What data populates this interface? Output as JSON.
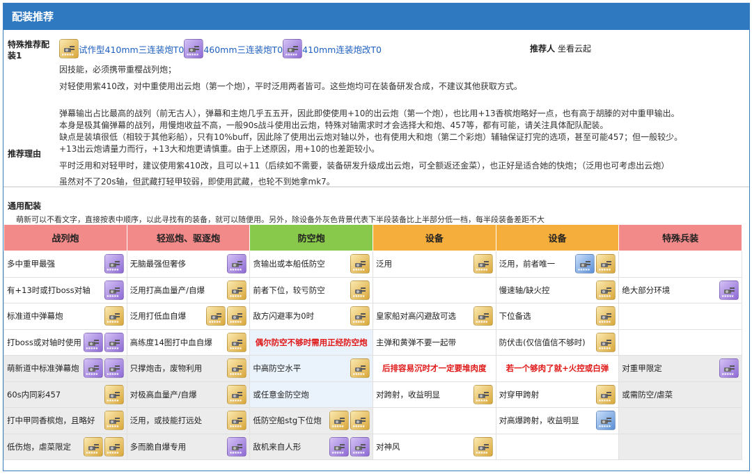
{
  "header": {
    "title": "配装推荐"
  },
  "special": {
    "label": "特殊推荐配装1",
    "equips": [
      {
        "name": "试作型410mm三连装炮T0",
        "color": "gold",
        "icon": "turret-icon"
      },
      {
        "name": "460mm三连装炮T0",
        "color": "purple",
        "icon": "turret-icon"
      },
      {
        "name": "410mm连装炮改T0",
        "color": "purple",
        "icon": "turret-icon"
      }
    ],
    "recommender_label": "推荐人",
    "recommender": "坐看云起",
    "notes": [
      "因技能，必须携带重樱战列炮；",
      "对轻使用紫410改，对中重使用出云炮（第一个炮），平时泛用两者皆可。这些炮均可在装备研发合成，不建议其他获取方式。"
    ],
    "reason_label": "推荐理由",
    "reasons": [
      "弹幕输出占比最高的战列（前无古人），弹幕和主炮几乎五五开，因此即使使用+10的出云炮（第一个炮），也比用+13香槟炮略好一点，也有高于胡滕的对中重甲输出。",
      "本身是极其偏弹幕的战列，用慢炮收益不高，一般90s战斗使用出云炮，特殊对轴需求时才会选择大和炮、457等，都有可能，请关注具体配队配装。",
      "缺点是装填很低（相较于其他彩船），只有10%buff，因此除了使用出云炮对轴以外，也有使用大和炮（第二个彩炮）辅轴保证打完的选项，甚至可能457；但一般较少。",
      "+13出云炮请量力而行，+13大和炮更请慎重。由于上述原因，用+10的也差距较小。",
      "平时泛用和对轻甲时，建议使用紫410改，且可以+11（后续如不需要，装备研发升级成出云炮，可全额返还金菜），也正好是适合她的快炮；（泛用也可考虑出云炮）",
      "虽然对不了20s轴，但武藏打轻甲较弱，即使用武藏，也轮不到她拿mk7。"
    ]
  },
  "general": {
    "title": "通用配装",
    "desc": "萌新可以不看文字，直接按表中顺序，以此寻找有的装备，就可以随便用。另外，除设备外灰色背景代表下半段装备比上半部分低一档，每半段装备差距不大"
  },
  "table": {
    "headers": [
      {
        "label": "战列炮",
        "color": "#f28a8a"
      },
      {
        "label": "轻巡炮、驱逐炮",
        "color": "#f28a8a"
      },
      {
        "label": "防空炮",
        "color": "#88c84a"
      },
      {
        "label": "设备",
        "color": "#f5ad3c"
      },
      {
        "label": "设备",
        "color": "#f5ad3c"
      },
      {
        "label": "特殊兵装",
        "color": "#f28a8a"
      }
    ],
    "rows": [
      [
        {
          "text": "多中重甲最强",
          "icons": [
            "purple"
          ]
        },
        {
          "text": "无脑最强但奢侈",
          "icons": [
            "purple"
          ]
        },
        {
          "text": "贪输出或本船低防空",
          "icons": [
            "gold"
          ]
        },
        {
          "text": "泛用",
          "icons": [
            "gold"
          ]
        },
        {
          "text": "泛用，前者唯一",
          "icons": [
            "blue",
            "gold"
          ]
        },
        {
          "text": "",
          "icons": []
        }
      ],
      [
        {
          "text": "有+13时或打boss对轴",
          "icons": [
            "purple"
          ]
        },
        {
          "text": "泛用打高血量产/自爆",
          "icons": [
            "gold"
          ]
        },
        {
          "text": "前者下位，较亏防空",
          "icons": [
            "gold"
          ]
        },
        {
          "text": "",
          "icons": []
        },
        {
          "text": "慢速轴/缺火控",
          "icons": [
            "gold"
          ]
        },
        {
          "text": "绝大部分环境",
          "icons": [
            "purple"
          ]
        }
      ],
      [
        {
          "text": "标准道中弹幕炮",
          "icons": [
            "gold"
          ]
        },
        {
          "text": "泛用打低血自爆",
          "icons": [
            "gold",
            "gold"
          ]
        },
        {
          "text": "敌方闪避率为0时",
          "icons": [
            "gold"
          ]
        },
        {
          "text": "皇家船对高闪避敌可选",
          "icons": [
            "gold"
          ]
        },
        {
          "text": "下位备选",
          "icons": [
            "gold"
          ]
        },
        {
          "text": "",
          "icons": []
        }
      ],
      [
        {
          "text": "打boss或对轴时使用",
          "icons": [
            "purple",
            "purple"
          ]
        },
        {
          "text": "高练度14图打中血自爆",
          "icons": [
            "gold"
          ]
        },
        {
          "text": "偶尔防空不够时需用正经防空炮",
          "icons": [],
          "red": true
        },
        {
          "text": "主弹和黄弹不要一起带",
          "icons": []
        },
        {
          "text": "防伏击(仅信值信不够时)",
          "icons": [
            "gold"
          ]
        },
        {
          "text": "",
          "icons": []
        }
      ],
      [
        {
          "text": "萌新道中标准弹幕炮",
          "icons": [
            "purple",
            "purple"
          ]
        },
        {
          "text": "只撑炮击，废物利用",
          "icons": [
            "gold"
          ]
        },
        {
          "text": "中高防空水平",
          "icons": [
            "gold"
          ]
        },
        {
          "text": "后排容易沉时才一定要堆肉度",
          "icons": [],
          "red": true
        },
        {
          "text": "若一个够肉了就+火控或白弹",
          "icons": [],
          "red": true
        },
        {
          "text": "对重甲限定",
          "icons": [
            "purple"
          ]
        }
      ],
      [
        {
          "text": "60s内同彩457",
          "icons": [
            "gold"
          ]
        },
        {
          "text": "对极高血量产/自爆",
          "icons": [
            "gold"
          ]
        },
        {
          "text": "或任意金防空炮",
          "icons": []
        },
        {
          "text": "对跨射，收益明显",
          "icons": [
            "gold"
          ]
        },
        {
          "text": "对穿甲跨射",
          "icons": [
            "gold"
          ]
        },
        {
          "text": "或需防空/虐菜",
          "icons": []
        }
      ],
      [
        {
          "text": "打中甲同香槟炮，且略好",
          "icons": [
            "gold"
          ]
        },
        {
          "text": "泛用，或技能打远处",
          "icons": [
            "gold"
          ]
        },
        {
          "text": "低防空船stg下位炮",
          "icons": [
            "gold",
            "gold"
          ]
        },
        {
          "text": "",
          "icons": []
        },
        {
          "text": "对高爆跨射，收益明显",
          "icons": [
            "blue"
          ]
        },
        {
          "text": "",
          "icons": []
        }
      ],
      [
        {
          "text": "低伤炮，虐菜限定",
          "icons": [
            "gold",
            "gold"
          ]
        },
        {
          "text": "多而脆自爆专用",
          "icons": [
            "purple"
          ]
        },
        {
          "text": "敌机来自人形",
          "icons": [
            "purple",
            "purple"
          ]
        },
        {
          "text": "对神风",
          "icons": [
            "gold"
          ]
        },
        {
          "text": "",
          "icons": []
        },
        {
          "text": "",
          "icons": []
        }
      ]
    ]
  }
}
